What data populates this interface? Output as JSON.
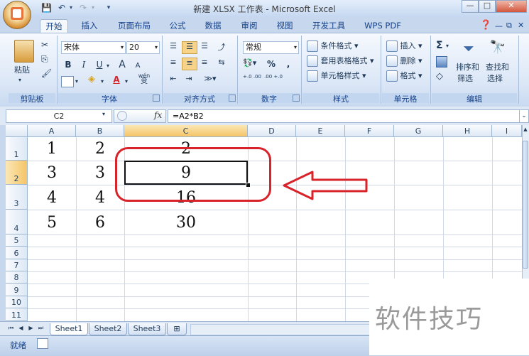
{
  "window": {
    "title": "新建 XLSX 工作表 - Microsoft Excel",
    "minimize": "—",
    "restore": "□",
    "close": "✕"
  },
  "tabs": [
    "开始",
    "插入",
    "页面布局",
    "公式",
    "数据",
    "审阅",
    "视图",
    "开发工具",
    "WPS PDF"
  ],
  "active_tab": "开始",
  "ribbon": {
    "clipboard": {
      "paste": "粘贴",
      "label": "剪贴板"
    },
    "font": {
      "name": "宋体",
      "size": "20",
      "label": "字体",
      "bold": "B",
      "italic": "I",
      "underline": "U",
      "grow": "A",
      "shrink": "A",
      "font_color": "A",
      "wen": "wén",
      "wen_char": "变"
    },
    "align": {
      "label": "对齐方式"
    },
    "number": {
      "format": "常规",
      "percent": "%",
      "comma": ",",
      "dec_inc": "+.0 .00",
      "dec_dec": ".00 +.0",
      "label": "数字"
    },
    "styles": {
      "cond": "条件格式",
      "table": "套用表格格式",
      "cell": "单元格样式",
      "label": "样式"
    },
    "cells": {
      "insert": "插入",
      "delete": "删除",
      "format": "格式",
      "label": "单元格"
    },
    "editing": {
      "sigma": "Σ",
      "sort": "排序和",
      "sort2": "筛选",
      "find": "查找和",
      "find2": "选择",
      "label": "编辑"
    }
  },
  "formula_bar": {
    "name_box": "C2",
    "fx": "fx",
    "formula": "=A2*B2"
  },
  "columns": [
    "A",
    "B",
    "C",
    "D",
    "E",
    "F",
    "G",
    "H",
    "I"
  ],
  "rows": [
    "1",
    "2",
    "3",
    "4",
    "5",
    "6",
    "7",
    "8",
    "9",
    "10",
    "11"
  ],
  "cells": [
    {
      "a": "1",
      "b": "2",
      "c": "2"
    },
    {
      "a": "3",
      "b": "3",
      "c": "9"
    },
    {
      "a": "4",
      "b": "4",
      "c": "16"
    },
    {
      "a": "5",
      "b": "6",
      "c": "30"
    }
  ],
  "sheets": [
    "Sheet1",
    "Sheet2",
    "Sheet3"
  ],
  "status": {
    "ready": "就绪"
  },
  "watermark": "软件技巧",
  "colors": {
    "highlight": "#d9232a",
    "selected_header": "#f5c567"
  }
}
